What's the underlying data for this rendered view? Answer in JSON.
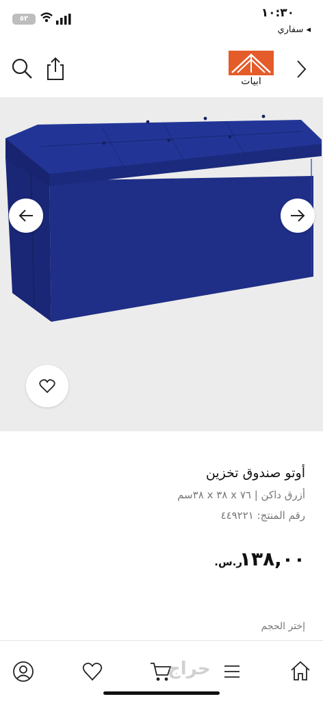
{
  "status_bar": {
    "time": "١٠:٣٠",
    "back_app": "◂ سفاري",
    "battery": "٥٣"
  },
  "header": {
    "logo_text": "ابيات"
  },
  "product": {
    "title": "أوتو صندوق تخزين",
    "variant": "أزرق داكن | ٧٦ x ٣٨ x ٣٨سم",
    "sku": "رقم المنتج: ٤٤٩٢٢١",
    "price": "١٣٨,٠٠",
    "currency": "ر.س.",
    "size_label": "إختر الحجم"
  },
  "colors": {
    "product": "#1e2f8a",
    "gallery_bg": "#ececec",
    "logo": "#e35c2a"
  },
  "watermark": "حراج"
}
